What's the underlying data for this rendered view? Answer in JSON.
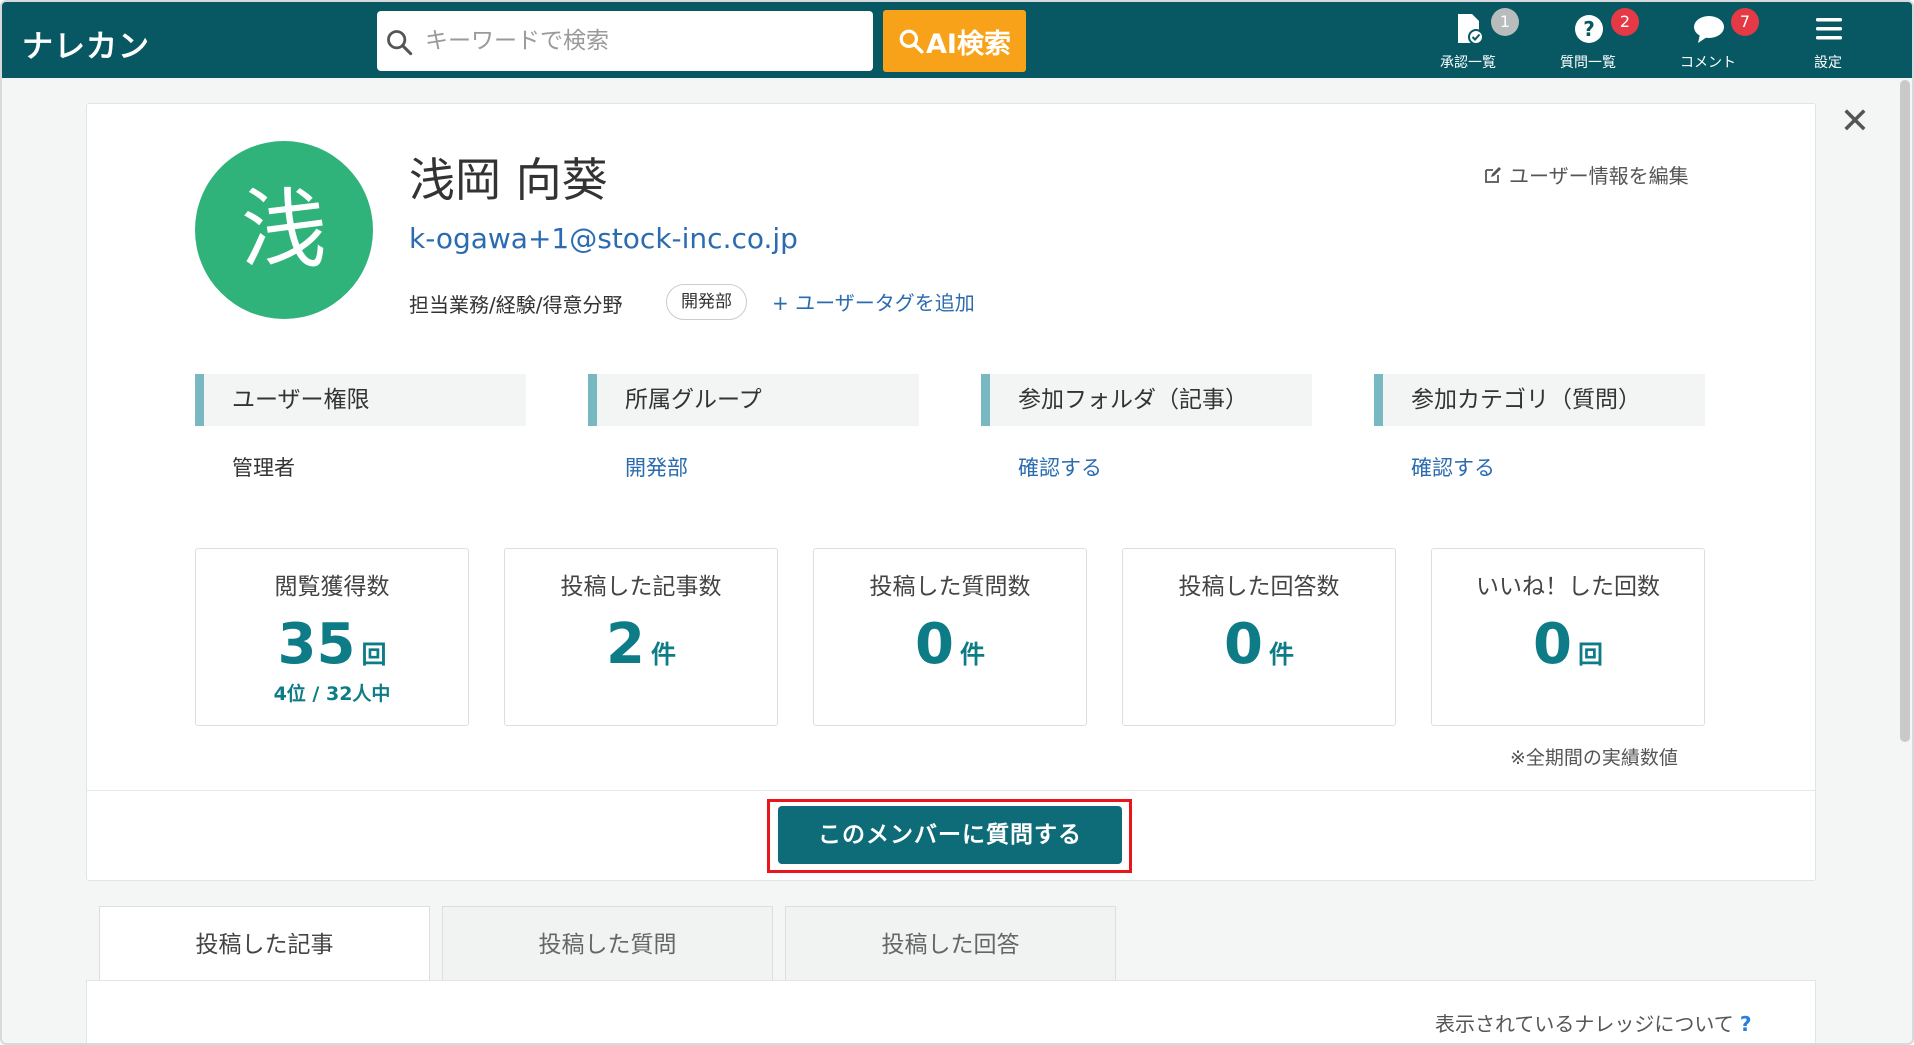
{
  "header": {
    "logo": "ナレカン",
    "search_placeholder": "キーワードで検索",
    "ai_search_label": "AI検索",
    "nav": [
      {
        "label": "承認一覧",
        "badge": "1",
        "icon": "approval-doc-icon",
        "badge_color": "#b8bcbd"
      },
      {
        "label": "質問一覧",
        "badge": "2",
        "icon": "question-icon",
        "badge_color": "#e63946"
      },
      {
        "label": "コメント",
        "badge": "7",
        "icon": "comment-icon",
        "badge_color": "#e63946"
      },
      {
        "label": "設定",
        "icon": "menu-icon"
      }
    ]
  },
  "profile": {
    "avatar_char": "浅",
    "name": "浅岡 向葵",
    "email": "k-ogawa+1@stock-inc.co.jp",
    "tags_label": "担当業務/経験/得意分野",
    "tag": "開発部",
    "add_tag_label": "+ ユーザータグを追加",
    "edit_label": "ユーザー情報を編集"
  },
  "info": [
    {
      "title": "ユーザー権限",
      "value": "管理者",
      "link": false
    },
    {
      "title": "所属グループ",
      "value": "開発部",
      "link": true
    },
    {
      "title": "参加フォルダ（記事）",
      "value": "確認する",
      "link": true
    },
    {
      "title": "参加カテゴリ（質問）",
      "value": "確認する",
      "link": true
    }
  ],
  "stats": [
    {
      "label": "閲覧獲得数",
      "value": "35",
      "unit": "回",
      "rank": "4位 / 32人中"
    },
    {
      "label": "投稿した記事数",
      "value": "2",
      "unit": "件"
    },
    {
      "label": "投稿した質問数",
      "value": "0",
      "unit": "件"
    },
    {
      "label": "投稿した回答数",
      "value": "0",
      "unit": "件"
    },
    {
      "label": "いいね！した回数",
      "value": "0",
      "unit": "回"
    }
  ],
  "stats_note": "※全期間の実績数値",
  "ask_button": "このメンバーに質問する",
  "tabs": [
    "投稿した記事",
    "投稿した質問",
    "投稿した回答"
  ],
  "about_knowledge": "表示されているナレッジについて",
  "about_knowledge_q": "?",
  "colors": {
    "header": "#085864",
    "accent": "#0e7c87",
    "ai_button": "#f7a219",
    "avatar": "#2fb37a",
    "highlight_outline": "#e8161b"
  }
}
